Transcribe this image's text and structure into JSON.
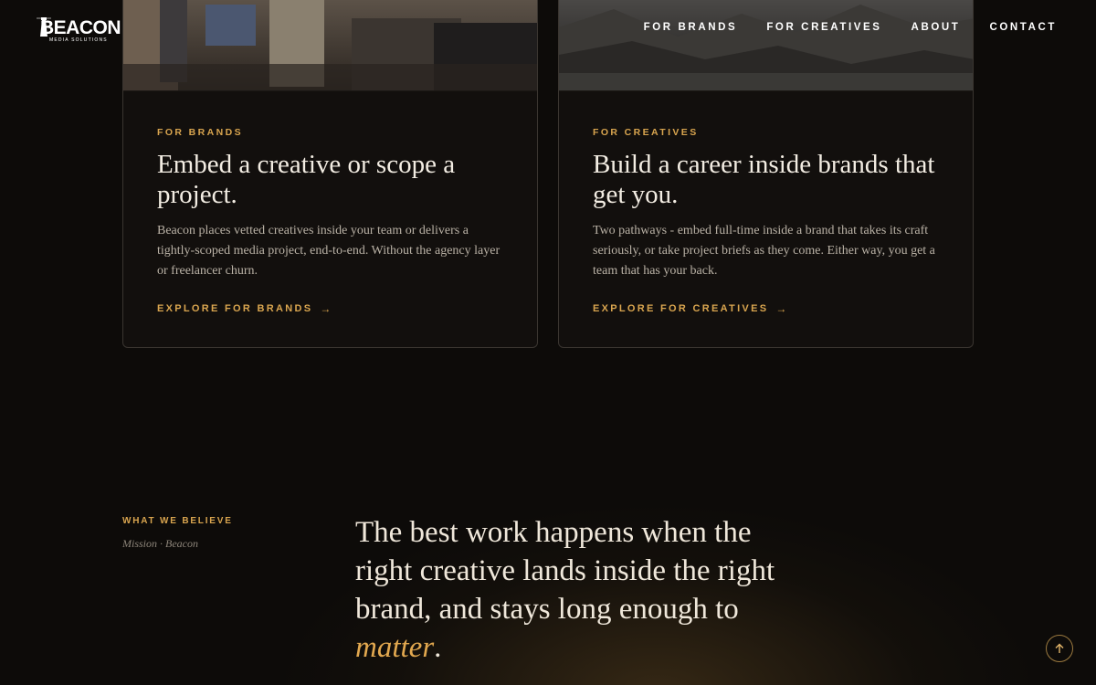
{
  "brand": {
    "logo_text": "BEACON",
    "logo_subtext": "MEDIA SOLUTIONS"
  },
  "nav": {
    "items": [
      {
        "label": "FOR BRANDS"
      },
      {
        "label": "FOR CREATIVES"
      },
      {
        "label": "ABOUT"
      },
      {
        "label": "CONTACT"
      }
    ]
  },
  "cards": [
    {
      "eyebrow": "FOR BRANDS",
      "title": "Embed a creative or scope a project.",
      "body": "Beacon places vetted creatives inside your team or delivers a tightly-scoped media project, end-to-end. Without the agency layer or freelancer churn.",
      "link_label": "EXPLORE FOR BRANDS",
      "link_icon": "arrow-right-icon"
    },
    {
      "eyebrow": "FOR CREATIVES",
      "title": "Build a career inside brands that get you.",
      "body": "Two pathways - embed full-time inside a brand that takes its craft seriously, or take project briefs as they come. Either way, you get a team that has your back.",
      "link_label": "EXPLORE FOR CREATIVES",
      "link_icon": "arrow-right-icon"
    }
  ],
  "mission": {
    "eyebrow": "WHAT WE BELIEVE",
    "caption": "Mission · Beacon",
    "quote_main": "The best work happens when the right creative lands inside the right brand, and stays long enough to ",
    "quote_emphasis": "matter",
    "quote_end": "."
  },
  "scroll_top": {
    "icon": "arrow-up-icon"
  },
  "colors": {
    "accent": "#d9a54f",
    "background": "#0d0b09",
    "card_border": "#3a3530"
  }
}
